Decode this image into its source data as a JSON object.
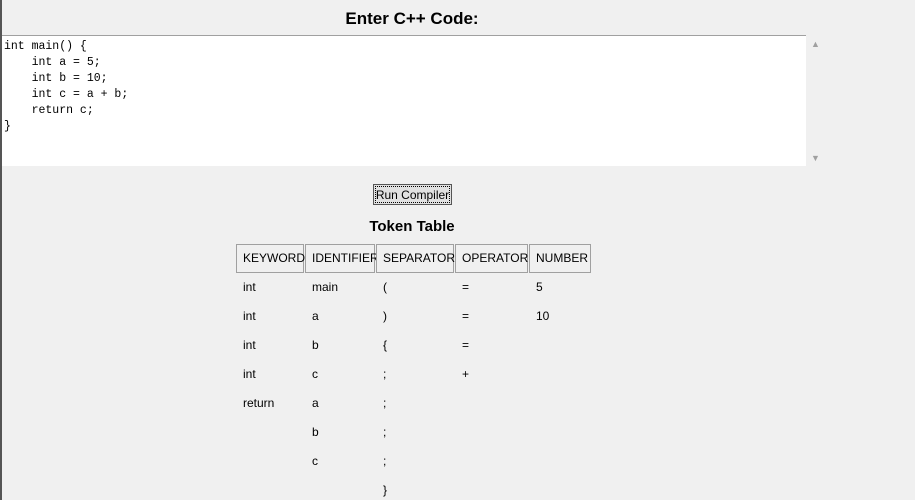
{
  "header": {
    "title": "Enter C++ Code:"
  },
  "editor": {
    "code": "int main() {\n    int a = 5;\n    int b = 10;\n    int c = a + b;\n    return c;\n}",
    "scroll_up_glyph": "▲",
    "scroll_down_glyph": "▼"
  },
  "actions": {
    "run_label": "Run Compiler"
  },
  "token_table": {
    "title": "Token Table",
    "columns": [
      "KEYWORD",
      "IDENTIFIER",
      "SEPARATOR",
      "OPERATOR",
      "NUMBER"
    ],
    "rows": [
      [
        "int",
        "main",
        "(",
        "=",
        "5"
      ],
      [
        "int",
        "a",
        ")",
        "=",
        "10"
      ],
      [
        "int",
        "b",
        "{",
        "=",
        ""
      ],
      [
        "int",
        "c",
        ";",
        "+",
        ""
      ],
      [
        "return",
        "a",
        ";",
        "",
        ""
      ],
      [
        "",
        "b",
        ";",
        "",
        ""
      ],
      [
        "",
        "c",
        ";",
        "",
        ""
      ],
      [
        "",
        "",
        "}",
        "",
        ""
      ]
    ]
  }
}
